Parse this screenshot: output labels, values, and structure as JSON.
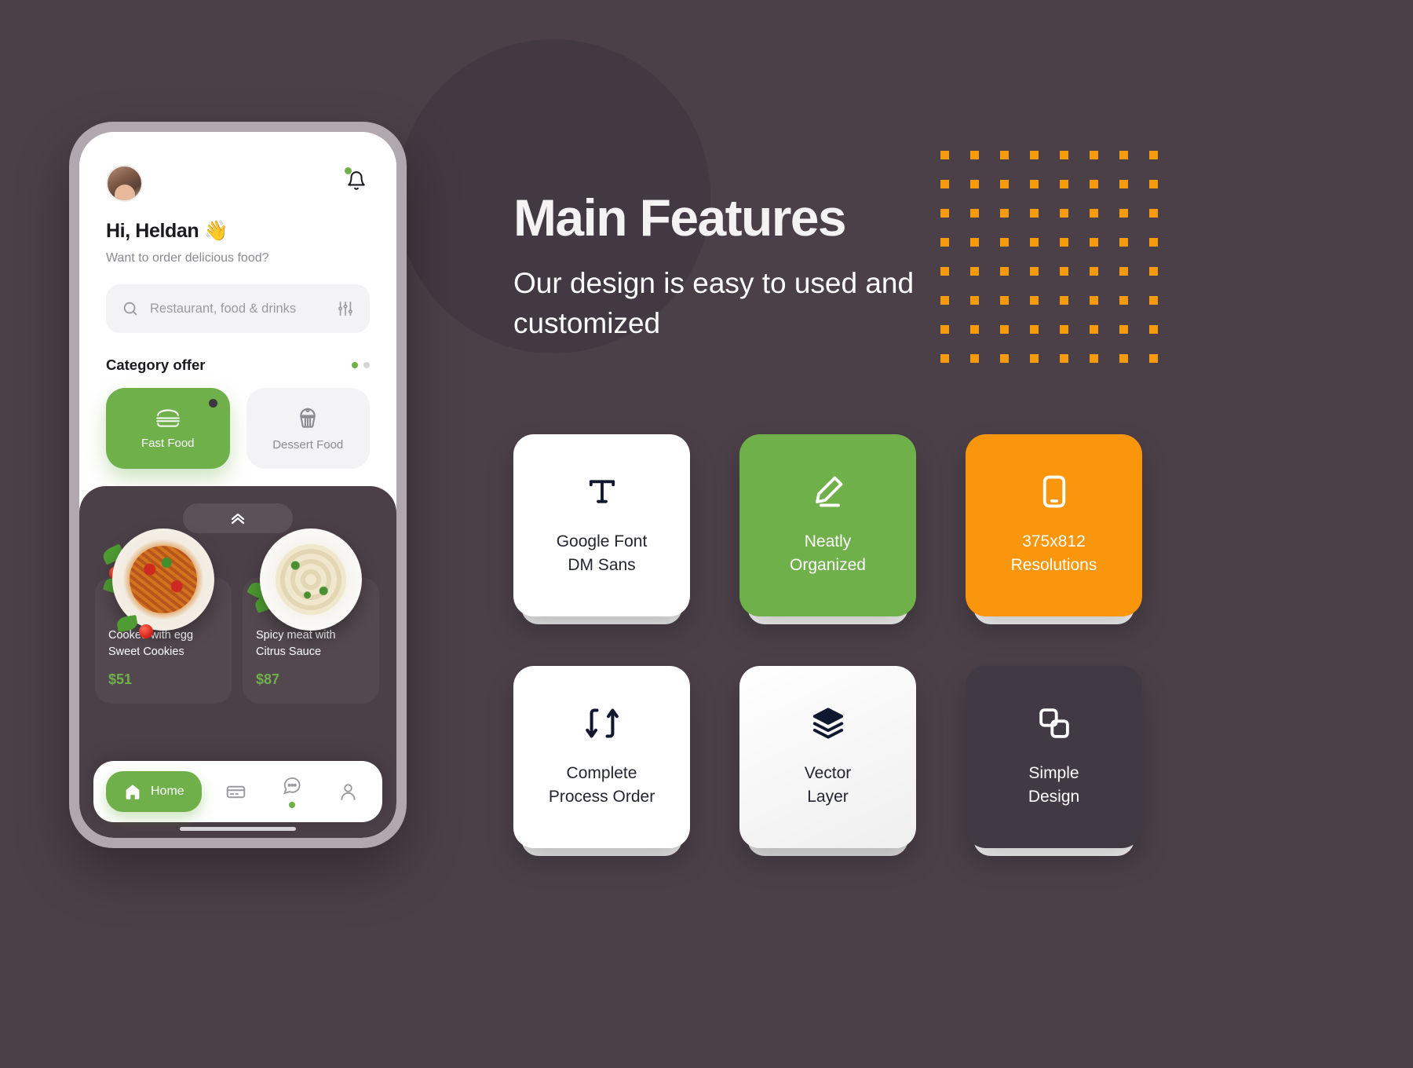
{
  "theme": {
    "background": "#4c4048",
    "accent_green": "#6fb04a",
    "accent_orange": "#f9960b",
    "dot_color": "#f59a0b",
    "dark_card": "#413944",
    "text_dark": "#23262f"
  },
  "phone": {
    "header": {
      "avatar_name": "avatar",
      "bell_icon": "bell-icon",
      "notification_dot": true,
      "greeting": "Hi, Heldan 👋",
      "subgreeting": "Want to order delicious food?"
    },
    "search": {
      "placeholder": "Restaurant, food & drinks",
      "search_icon": "search-icon",
      "filter_icon": "sliders-icon"
    },
    "category": {
      "title": "Category offer",
      "items": [
        {
          "label": "Fast Food",
          "icon": "burger-icon",
          "active": true,
          "badge": true
        },
        {
          "label": "Dessert Food",
          "icon": "cupcake-icon",
          "active": false,
          "badge": false
        }
      ]
    },
    "drawer_handle_icon": "double-chevron-up-icon",
    "foods": [
      {
        "name": "Cooked with egg\nSweet Cookies",
        "name_line1": "Cooked with egg",
        "name_line2": "Sweet Cookies",
        "price": "$51",
        "image": "pasta-bolognese-plate"
      },
      {
        "name": "Spicy meat with\nCitrus Sauce",
        "name_line1": "Spicy meat with",
        "name_line2": "Citrus Sauce",
        "price": "$87",
        "image": "tortellini-cream-plate"
      }
    ],
    "bottom_nav": [
      {
        "label": "Home",
        "icon": "home-icon",
        "active": true,
        "dot": false
      },
      {
        "label": "",
        "icon": "card-icon",
        "active": false,
        "dot": false
      },
      {
        "label": "",
        "icon": "chat-bubble-icon",
        "active": false,
        "dot": true
      },
      {
        "label": "",
        "icon": "person-icon",
        "active": false,
        "dot": false
      }
    ]
  },
  "right": {
    "title": "Main Features",
    "subtitle": "Our design is easy to used and customized"
  },
  "feature_cards": [
    {
      "line1": "Google Font",
      "line2": "DM Sans",
      "icon": "text-type-icon",
      "style": "white"
    },
    {
      "line1": "Neatly",
      "line2": "Organized",
      "icon": "pencil-edit-icon",
      "style": "green"
    },
    {
      "line1": "375x812",
      "line2": "Resolutions",
      "icon": "mobile-device-icon",
      "style": "orange"
    },
    {
      "line1": "Complete",
      "line2": "Process Order",
      "icon": "transfer-arrows-icon",
      "style": "white"
    },
    {
      "line1": "Vector",
      "line2": "Layer",
      "icon": "layers-icon",
      "style": "greenish"
    },
    {
      "line1": "Simple",
      "line2": "Design",
      "icon": "copy-shapes-icon",
      "style": "dark"
    }
  ]
}
